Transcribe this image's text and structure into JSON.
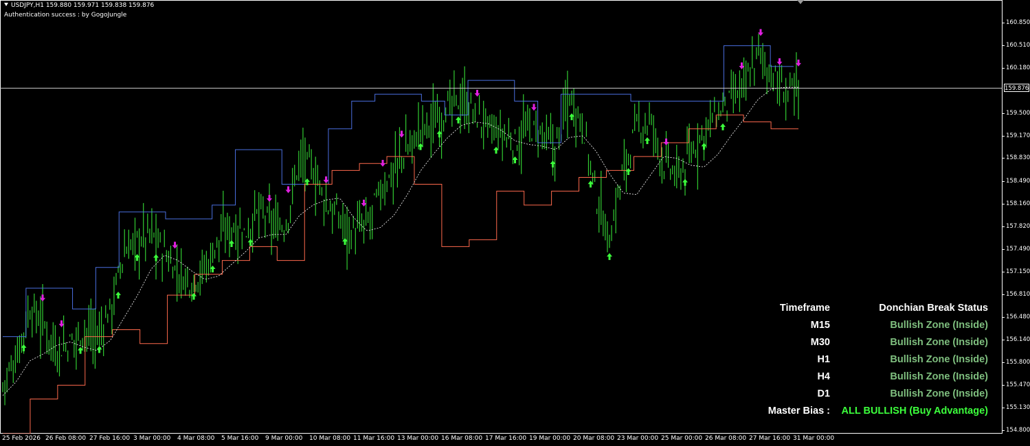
{
  "header": {
    "symbol_line": "USDJPY,H1  159.880 159.971 159.838 159.876",
    "auth_line": "Authentication success : by GogoJungle"
  },
  "price_axis": {
    "labels": [
      "160.850",
      "160.510",
      "160.180",
      "159.876",
      "159.500",
      "159.170",
      "158.830",
      "158.490",
      "158.160",
      "157.820",
      "157.490",
      "157.150",
      "156.810",
      "156.480",
      "156.140",
      "155.800",
      "155.470",
      "155.130",
      "154.800"
    ],
    "current_price": "159.876"
  },
  "time_axis": {
    "labels": [
      "25 Feb 2026",
      "26 Feb 08:00",
      "27 Feb 16:00",
      "3 Mar 00:00",
      "4 Mar 08:00",
      "5 Mar 16:00",
      "9 Mar 00:00",
      "10 Mar 08:00",
      "11 Mar 16:00",
      "13 Mar 00:00",
      "16 Mar 08:00",
      "17 Mar 16:00",
      "19 Mar 00:00",
      "20 Mar 08:00",
      "23 Mar 00:00",
      "25 Mar 00:00",
      "26 Mar 08:00",
      "27 Mar 16:00",
      "31 Mar 00:00"
    ]
  },
  "status_panel": {
    "header_left": "Timeframe",
    "header_right": "Donchian Break Status",
    "rows": [
      {
        "tf": "M15",
        "status": "Bullish Zone (Inside)"
      },
      {
        "tf": "M30",
        "status": "Bullish Zone (Inside)"
      },
      {
        "tf": "H1",
        "status": "Bullish Zone (Inside)"
      },
      {
        "tf": "H4",
        "status": "Bullish Zone (Inside)"
      },
      {
        "tf": "D1",
        "status": "Bullish Zone (Inside)"
      }
    ],
    "master_label": "Master Bias :",
    "master_value": "ALL BULLISH (Buy Advantage)"
  },
  "colors": {
    "background": "#000000",
    "candle": "#32cd32",
    "upper_band": "#4a6fe0",
    "lower_band": "#ff6a4d",
    "middle_band": "#ffffff",
    "up_arrow": "#3cff3c",
    "down_arrow": "#e020e0",
    "status_zone": "#7fbf7f",
    "master_bias": "#3cff3c",
    "text": "#ffffff"
  },
  "chart_data": {
    "type": "line",
    "symbol": "USDJPY",
    "timeframe": "H1",
    "y_range": [
      154.8,
      161.06
    ],
    "series_closes": [
      155.5,
      155.9,
      156.6,
      156.4,
      156.0,
      156.1,
      156.3,
      156.2,
      156.6,
      157.4,
      157.6,
      157.7,
      157.4,
      157.1,
      157.0,
      157.2,
      157.6,
      157.8,
      157.7,
      158.0,
      157.8,
      157.8,
      158.8,
      158.6,
      158.1,
      157.9,
      157.7,
      157.8,
      158.3,
      158.6,
      158.9,
      159.2,
      159.3,
      159.5,
      159.6,
      159.4,
      159.2,
      159.1,
      159.0,
      159.2,
      159.1,
      158.9,
      159.7,
      159.3,
      158.2,
      157.6,
      158.6,
      159.2,
      159.3,
      158.7,
      158.5,
      158.8,
      159.2,
      159.4,
      159.6,
      159.8,
      160.3,
      160.0,
      159.7,
      159.8
    ],
    "upper_band": [
      156.2,
      156.9,
      156.9,
      156.6,
      157.2,
      158.0,
      158.0,
      157.9,
      157.9,
      158.1,
      158.9,
      158.9,
      158.4,
      158.4,
      159.2,
      159.6,
      159.7,
      159.7,
      159.6,
      159.4,
      159.9,
      159.9,
      159.6,
      159.0,
      159.7,
      159.7,
      159.7,
      159.6,
      159.6,
      159.6,
      159.6,
      160.4,
      160.4,
      160.1
    ],
    "lower_band": [
      154.8,
      155.3,
      155.5,
      156.2,
      156.3,
      156.1,
      156.8,
      157.1,
      157.3,
      157.5,
      157.3,
      158.4,
      158.6,
      158.7,
      158.8,
      158.4,
      157.5,
      157.6,
      158.3,
      158.1,
      158.3,
      158.5,
      158.6,
      158.8,
      159.0,
      159.2,
      159.4,
      159.3,
      159.2
    ],
    "master_bias": "ALL BULLISH (Buy Advantage)"
  }
}
